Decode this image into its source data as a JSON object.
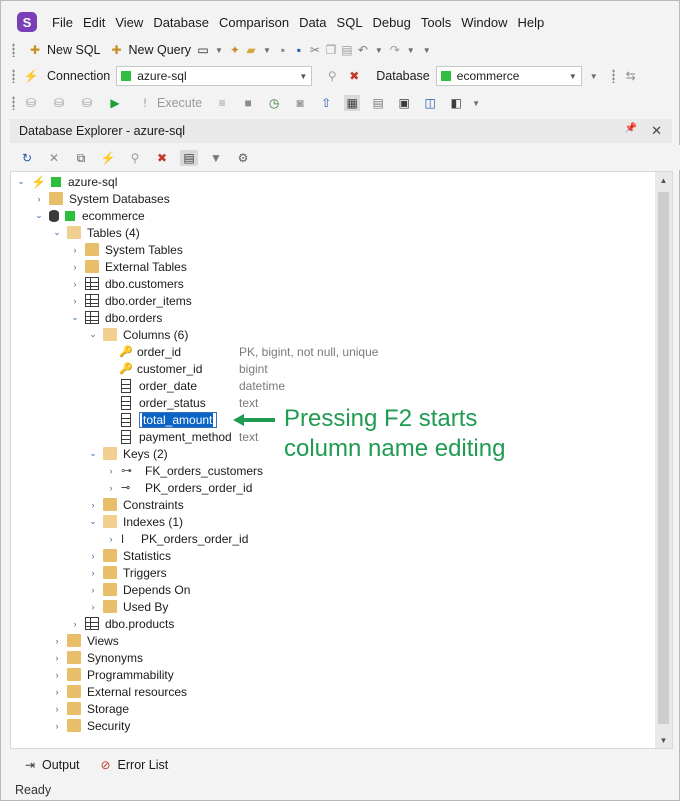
{
  "app": {
    "logo_letter": "S",
    "accent": "#7a3fb8"
  },
  "menu": [
    "File",
    "Edit",
    "View",
    "Database",
    "Comparison",
    "Data",
    "SQL",
    "Debug",
    "Tools",
    "Window",
    "Help"
  ],
  "toolbar1": {
    "new_sql": "New SQL",
    "new_query": "New Query"
  },
  "toolbar2": {
    "connection_label": "Connection",
    "connection_value": "azure-sql",
    "database_label": "Database",
    "database_value": "ecommerce"
  },
  "toolbar3": {
    "execute": "Execute"
  },
  "panel": {
    "title": "Database Explorer - azure-sql",
    "pin": "📌",
    "close": "✕"
  },
  "tree": {
    "root": "azure-sql",
    "system_databases": "System Databases",
    "database": "ecommerce",
    "tables": "Tables (4)",
    "system_tables": "System Tables",
    "external_tables": "External Tables",
    "t_customers": "dbo.customers",
    "t_order_items": "dbo.order_items",
    "t_orders": "dbo.orders",
    "columns": "Columns (6)",
    "cols": [
      {
        "name": "order_id",
        "type": "PK, bigint, not null, unique"
      },
      {
        "name": "customer_id",
        "type": "bigint"
      },
      {
        "name": "order_date",
        "type": "datetime"
      },
      {
        "name": "order_status",
        "type": "text"
      },
      {
        "name": "total_amount",
        "type": ""
      },
      {
        "name": "payment_method",
        "type": "text"
      }
    ],
    "keys": "Keys (2)",
    "fk": "FK_orders_customers",
    "pk": "PK_orders_order_id",
    "constraints": "Constraints",
    "indexes": "Indexes (1)",
    "index_pk": "PK_orders_order_id",
    "statistics": "Statistics",
    "triggers": "Triggers",
    "depends_on": "Depends On",
    "used_by": "Used By",
    "t_products": "dbo.products",
    "views": "Views",
    "synonyms": "Synonyms",
    "programmability": "Programmability",
    "external_resources": "External resources",
    "storage": "Storage",
    "security": "Security"
  },
  "annotation": {
    "line1": "Pressing F2 starts",
    "line2": "column name editing",
    "color": "#1f9b52"
  },
  "bottom": {
    "output": "Output",
    "error_list": "Error List"
  },
  "status": "Ready"
}
